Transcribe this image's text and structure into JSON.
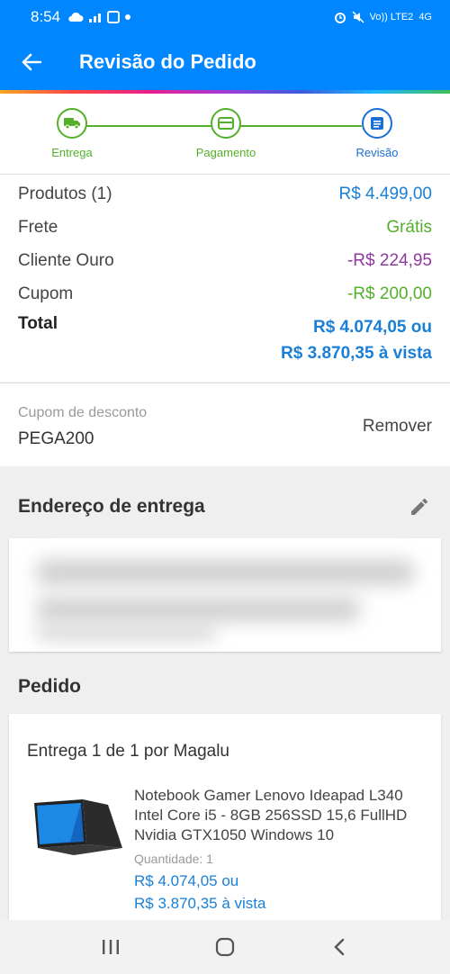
{
  "status_bar": {
    "time": "8:54",
    "network": "Vo)) LTE2",
    "network_type": "4G"
  },
  "app_bar": {
    "title": "Revisão do Pedido",
    "back_icon": "arrow-left-icon"
  },
  "stepper": {
    "steps": [
      {
        "label": "Entrega",
        "icon": "truck-icon",
        "state": "done"
      },
      {
        "label": "Pagamento",
        "icon": "card-icon",
        "state": "done"
      },
      {
        "label": "Revisão",
        "icon": "list-icon",
        "state": "active"
      }
    ],
    "colors": {
      "done": "#53b02a",
      "active": "#1a6fd6"
    }
  },
  "summary": {
    "products_label": "Produtos (1)",
    "products_value": "R$ 4.499,00",
    "shipping_label": "Frete",
    "shipping_value": "Grátis",
    "gold_label": "Cliente Ouro",
    "gold_value": "-R$ 224,95",
    "coupon_label": "Cupom",
    "coupon_value": "-R$ 200,00",
    "total_label": "Total",
    "total_value_line1": "R$ 4.074,05 ou",
    "total_value_line2": "R$ 3.870,35 à vista"
  },
  "coupon": {
    "label": "Cupom de desconto",
    "code": "PEGA200",
    "remove_label": "Remover"
  },
  "address": {
    "title": "Endereço de entrega",
    "edit_icon": "pencil-icon"
  },
  "order": {
    "title": "Pedido",
    "delivery_title": "Entrega 1 de 1 por Magalu",
    "product_name": "Notebook Gamer Lenovo Ideapad L340 Intel Core i5 - 8GB 256SSD 15,6 FullHD Nvidia GTX1050 Windows 10",
    "quantity": "Quantidade:  1",
    "price_line1": "R$ 4.074,05 ou",
    "price_line2": "R$ 3.870,35 à vista"
  },
  "colors": {
    "primary": "#0086ff",
    "price_blue": "#1a7fd6",
    "green": "#53b02a",
    "purple": "#8e3a9d"
  }
}
